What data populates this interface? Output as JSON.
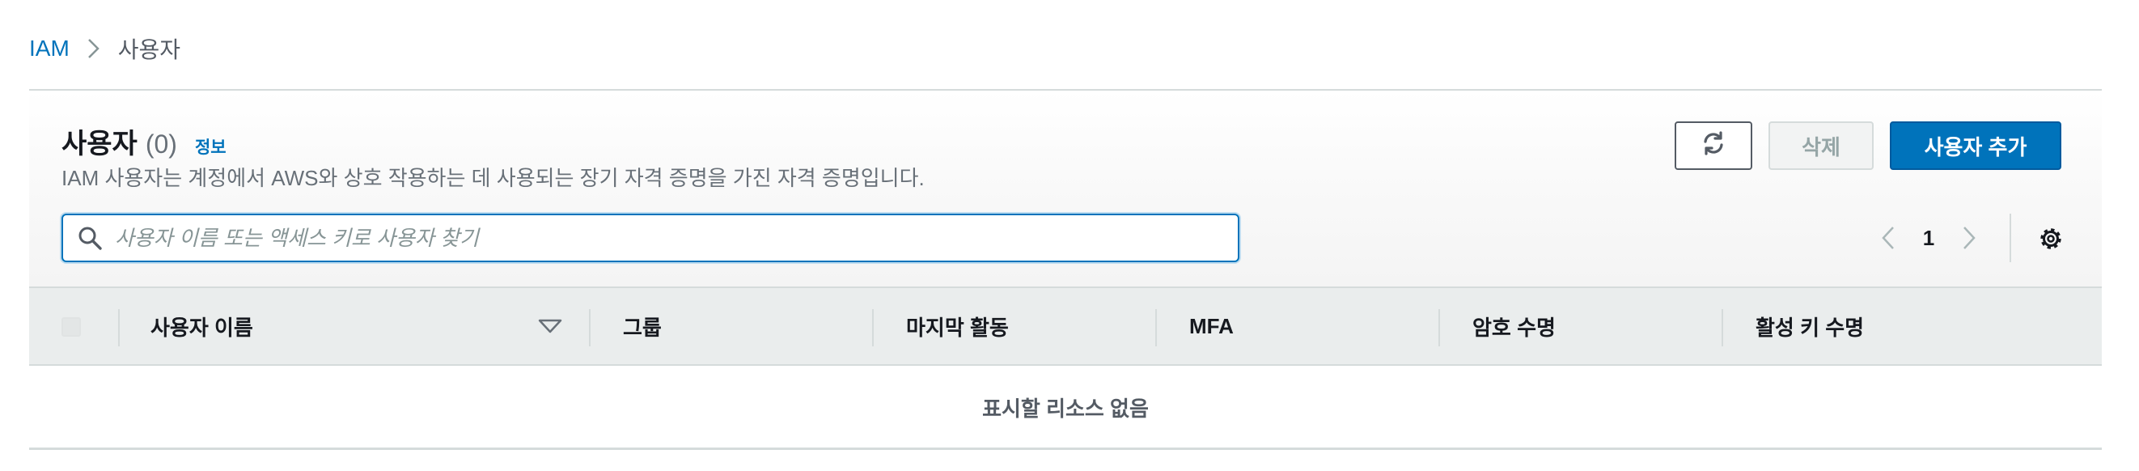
{
  "breadcrumb": {
    "root": "IAM",
    "current": "사용자"
  },
  "panel": {
    "title": "사용자",
    "count": "(0)",
    "info": "정보",
    "description": "IAM 사용자는 계정에서 AWS와 상호 작용하는 데 사용되는 장기 자격 증명을 가진 자격 증명입니다."
  },
  "actions": {
    "refresh_icon": "refresh-icon",
    "delete_label": "삭제",
    "add_label": "사용자 추가"
  },
  "search": {
    "placeholder": "사용자 이름 또는 액세스 키로 사용자 찾기",
    "value": ""
  },
  "pagination": {
    "current_page": "1"
  },
  "table": {
    "columns": [
      "사용자 이름",
      "그룹",
      "마지막 활동",
      "MFA",
      "암호 수명",
      "활성 키 수명"
    ],
    "empty_text": "표시할 리소스 없음"
  },
  "colors": {
    "primary": "#0073bb",
    "header_bg": "#eaeded",
    "border": "#d5dbdb",
    "muted_text": "#687078"
  }
}
